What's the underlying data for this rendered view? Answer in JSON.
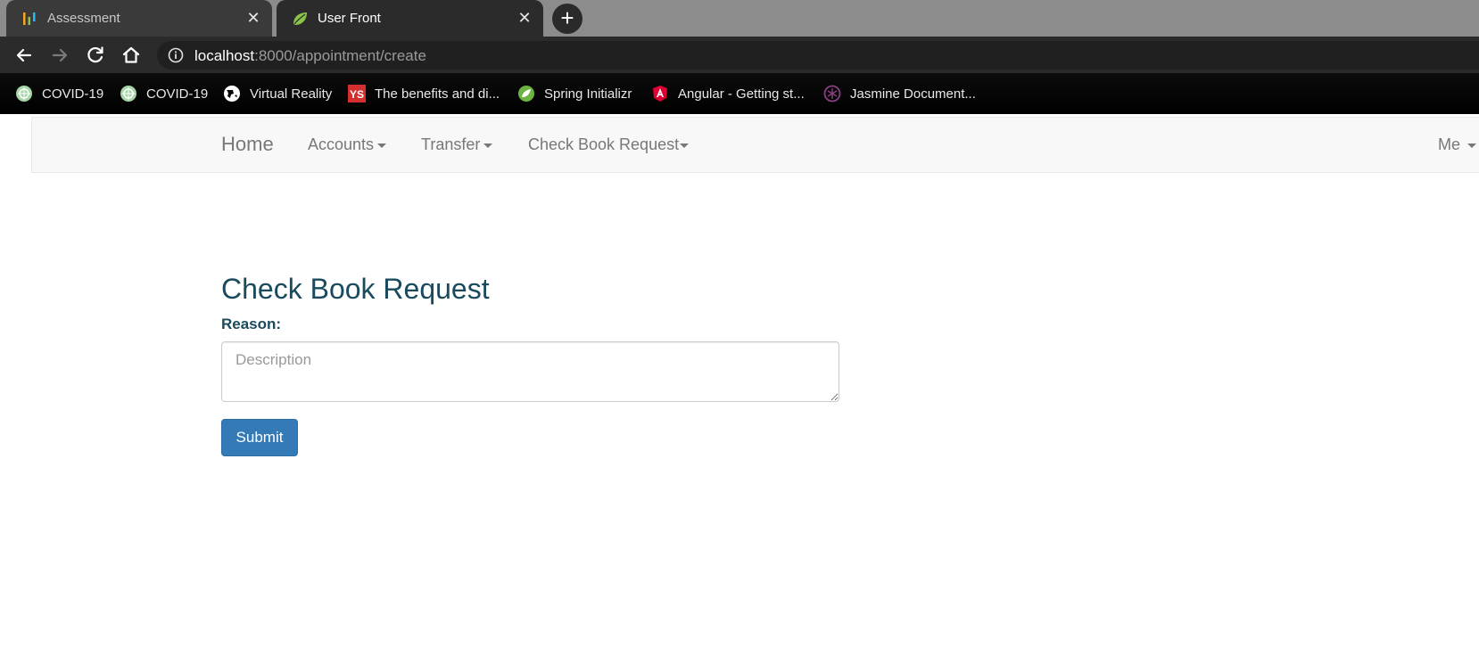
{
  "browser": {
    "tabs": [
      {
        "title": "Assessment",
        "favicon": "assessment-icon",
        "active": false
      },
      {
        "title": "User Front",
        "favicon": "spring-leaf-icon",
        "active": true
      }
    ],
    "new_tab_label": "+",
    "close_glyph": "✕",
    "address": {
      "host": "localhost",
      "path": ":8000/appointment/create"
    },
    "bookmarks": [
      {
        "label": "COVID-19",
        "icon": "covid-icon"
      },
      {
        "label": "COVID-19",
        "icon": "covid-icon"
      },
      {
        "label": "Virtual Reality",
        "icon": "globe-icon"
      },
      {
        "label": "The benefits and di...",
        "icon": "ys-icon"
      },
      {
        "label": "Spring Initializr",
        "icon": "spring-icon"
      },
      {
        "label": "Angular - Getting st...",
        "icon": "angular-icon"
      },
      {
        "label": "Jasmine Document...",
        "icon": "jasmine-icon"
      }
    ]
  },
  "navbar": {
    "brand": "Home",
    "items": [
      {
        "label": "Accounts"
      },
      {
        "label": "Transfer"
      },
      {
        "label": "Check Book Request"
      }
    ],
    "right_item": "Me"
  },
  "form": {
    "heading": "Check Book Request",
    "reason_label": "Reason:",
    "description_placeholder": "Description",
    "description_value": "",
    "submit_label": "Submit"
  },
  "colors": {
    "heading": "#1a4a5e",
    "primary_button": "#337ab7",
    "navbar_bg": "#f8f8f8"
  }
}
